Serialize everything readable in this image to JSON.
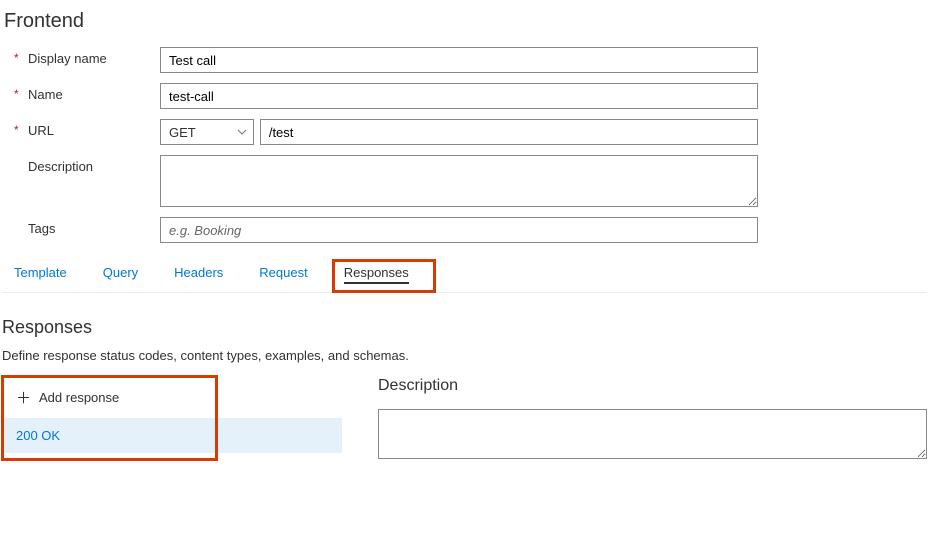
{
  "header": {
    "title": "Frontend"
  },
  "form": {
    "displayName": {
      "label": "Display name",
      "value": "Test call"
    },
    "name": {
      "label": "Name",
      "value": "test-call"
    },
    "url": {
      "label": "URL",
      "method": "GET",
      "path": "/test"
    },
    "description": {
      "label": "Description",
      "value": ""
    },
    "tags": {
      "label": "Tags",
      "value": "",
      "placeholder": "e.g. Booking"
    }
  },
  "tabs": {
    "template": "Template",
    "query": "Query",
    "headers": "Headers",
    "request": "Request",
    "responses": "Responses"
  },
  "responsesSection": {
    "title": "Responses",
    "description": "Define response status codes, content types, examples, and schemas.",
    "addLabel": "Add response",
    "items": [
      {
        "label": "200 OK"
      }
    ],
    "detail": {
      "descLabel": "Description",
      "descValue": ""
    }
  }
}
